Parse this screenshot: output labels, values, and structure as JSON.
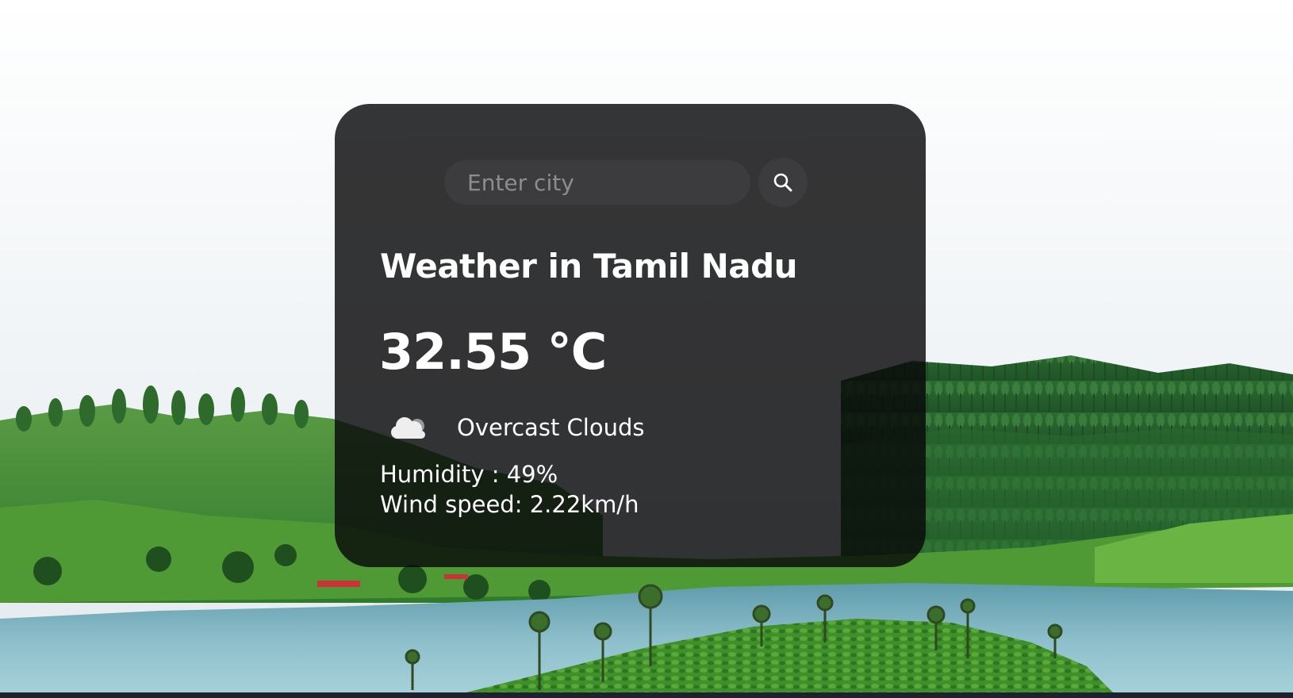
{
  "search": {
    "placeholder": "Enter city",
    "value": "",
    "button_icon": "search-icon"
  },
  "weather": {
    "title": "Weather in Tamil Nadu",
    "temperature": "32.55 °C",
    "condition_icon": "cloud-icon",
    "condition": "Overcast Clouds",
    "humidity": "Humidity : 49%",
    "wind_speed": "Wind speed: 2.22km/h"
  },
  "colors": {
    "card_background": "#0a0a0c",
    "search_background": "#3c3c3e",
    "placeholder": "#8d8d8f",
    "text": "#ffffff",
    "bottom_bar": "#1f2030"
  }
}
